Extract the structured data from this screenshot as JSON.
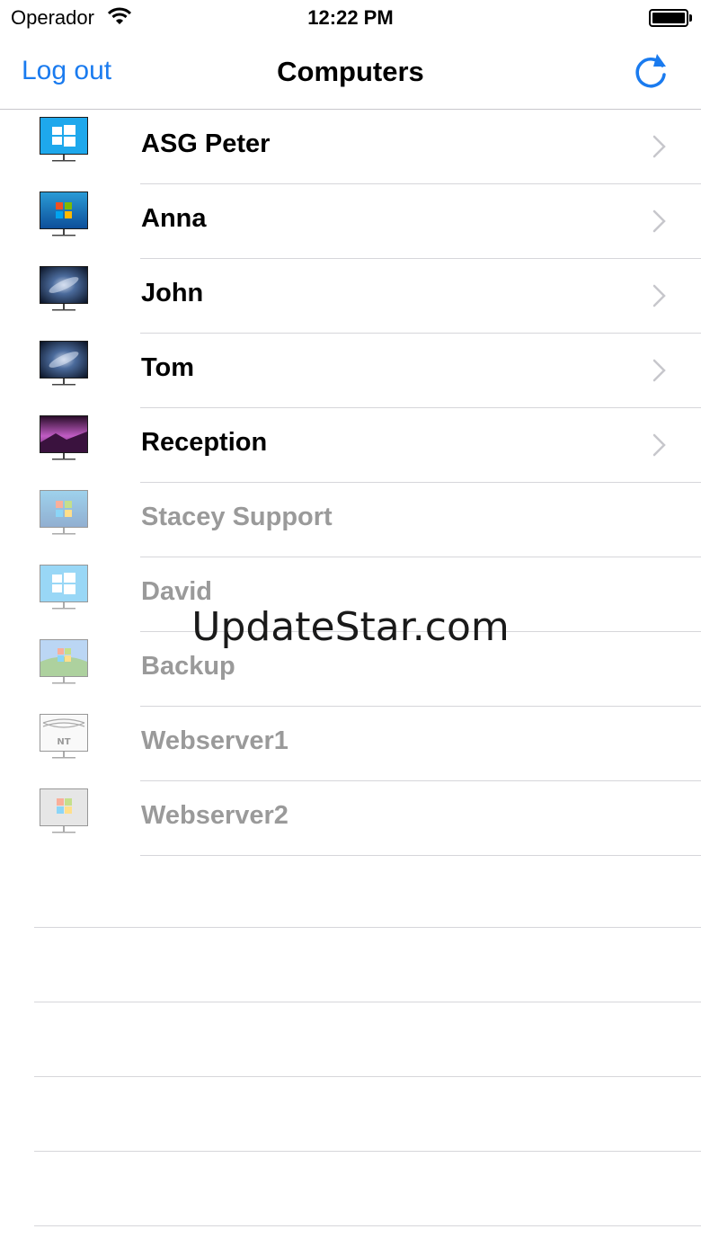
{
  "status_bar": {
    "carrier": "Operador",
    "time": "12:22 PM"
  },
  "nav": {
    "logout_label": "Log out",
    "title": "Computers",
    "refresh_icon": "refresh-icon"
  },
  "colors": {
    "accent": "#1a7bef",
    "offline_text": "#9a9a9a",
    "separator": "#d6d6da"
  },
  "computers": [
    {
      "name": "ASG Peter",
      "os": "windows-8",
      "online": true
    },
    {
      "name": "Anna",
      "os": "windows-7",
      "online": true
    },
    {
      "name": "John",
      "os": "mac-galaxy",
      "online": true
    },
    {
      "name": "Tom",
      "os": "mac-galaxy",
      "online": true
    },
    {
      "name": "Reception",
      "os": "mac-pink",
      "online": true
    },
    {
      "name": "Stacey Support",
      "os": "windows-7",
      "online": false
    },
    {
      "name": "David",
      "os": "windows-8",
      "online": false
    },
    {
      "name": "Backup",
      "os": "windows-xp",
      "online": false
    },
    {
      "name": "Webserver1",
      "os": "windows-nt",
      "online": false
    },
    {
      "name": "Webserver2",
      "os": "windows-server",
      "online": false
    }
  ],
  "watermark": "UpdateStar.com"
}
